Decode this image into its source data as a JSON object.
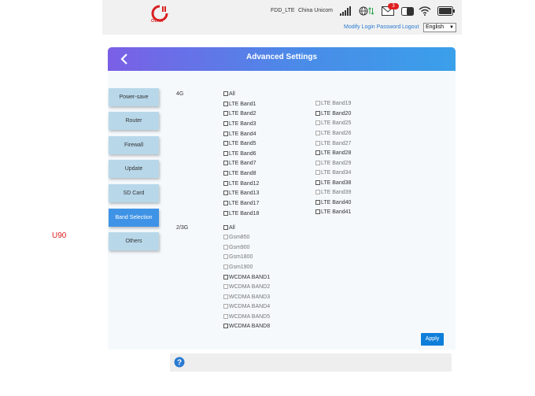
{
  "topbar": {
    "logo_text": "OLAX",
    "logo_sup": "Hi",
    "network_type": "FDD_LTE",
    "carrier": "China Unicom",
    "mail_count": "3",
    "modify_password": "Modify Login Password",
    "logout": "Logout",
    "language": "English"
  },
  "header": {
    "title": "Advanced Settings"
  },
  "menu": [
    {
      "label": "Power-save"
    },
    {
      "label": "Router"
    },
    {
      "label": "Firewall"
    },
    {
      "label": "Update"
    },
    {
      "label": "SD Card"
    },
    {
      "label": "Band Selection",
      "active": true
    },
    {
      "label": "Others"
    }
  ],
  "bands": {
    "lte_label": "4G",
    "lte_left": [
      "All",
      "LTE Band1",
      "LTE Band2",
      "LTE Band3",
      "LTE Band4",
      "LTE Band5",
      "LTE Band6",
      "LTE Band7",
      "LTE Band8",
      "LTE Band12",
      "LTE Band13",
      "LTE Band17",
      "LTE Band18"
    ],
    "lte_right": [
      "LTE Band19",
      "LTE Band20",
      "LTE Band25",
      "LTE Band26",
      "LTE Band27",
      "LTE Band28",
      "LTE Band29",
      "LTE Band34",
      "LTE Band38",
      "LTE Band39",
      "LTE Band40",
      "LTE Band41"
    ],
    "g23_label": "2/3G",
    "g23": [
      "All",
      "Gsm850",
      "Gsm900",
      "Gsm1800",
      "Gsm1900",
      "WCDMA BAND1",
      "WCDMA BAND2",
      "WCDMA BAND3",
      "WCDMA BAND4",
      "WCDMA BAND5",
      "WCDMA BAND8"
    ]
  },
  "apply_label": "Apply",
  "side_label": "U90",
  "colors": {
    "accent": "#3f93e6",
    "menu": "#b8d8ea",
    "apply": "#0d7ed9",
    "badge": "#e02020"
  }
}
